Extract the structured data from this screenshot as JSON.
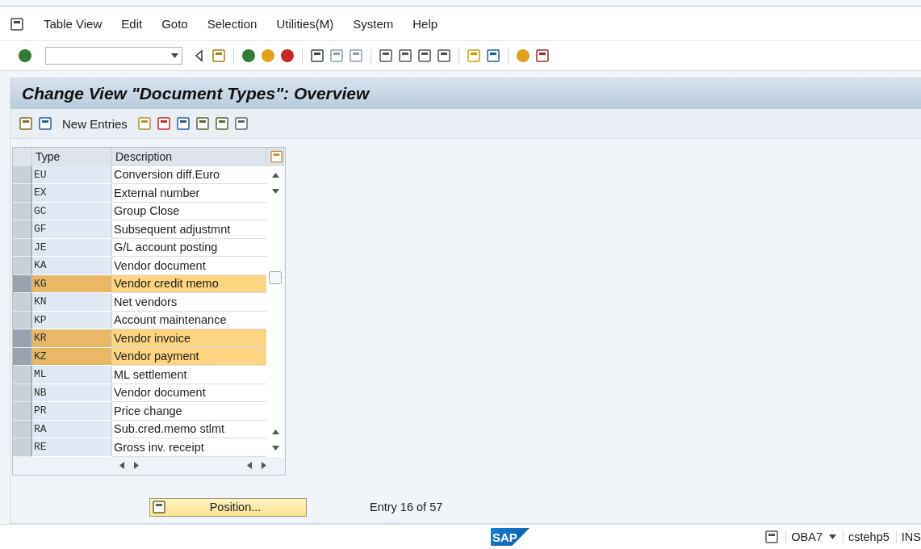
{
  "menu": [
    "Table View",
    "Edit",
    "Goto",
    "Selection",
    "Utilities(M)",
    "System",
    "Help"
  ],
  "title": "Change View \"Document Types\": Overview",
  "app_toolbar": {
    "new_entries": "New Entries"
  },
  "table": {
    "columns": [
      "Type",
      "Description"
    ],
    "rows": [
      {
        "type": "EU",
        "description": "Conversion diff.Euro",
        "selected": false
      },
      {
        "type": "EX",
        "description": "External number",
        "selected": false
      },
      {
        "type": "GC",
        "description": "Group Close",
        "selected": false
      },
      {
        "type": "GF",
        "description": "Subsequent adjustmnt",
        "selected": false
      },
      {
        "type": "JE",
        "description": "G/L account posting",
        "selected": false
      },
      {
        "type": "KA",
        "description": "Vendor document",
        "selected": false
      },
      {
        "type": "KG",
        "description": "Vendor credit memo",
        "selected": true
      },
      {
        "type": "KN",
        "description": "Net vendors",
        "selected": false
      },
      {
        "type": "KP",
        "description": "Account maintenance",
        "selected": false
      },
      {
        "type": "KR",
        "description": "Vendor invoice",
        "selected": true
      },
      {
        "type": "KZ",
        "description": "Vendor payment",
        "selected": true
      },
      {
        "type": "ML",
        "description": "ML settlement",
        "selected": false
      },
      {
        "type": "NB",
        "description": "Vendor document",
        "selected": false
      },
      {
        "type": "PR",
        "description": "Price change",
        "selected": false
      },
      {
        "type": "RA",
        "description": "Sub.cred.memo stlmt",
        "selected": false
      },
      {
        "type": "RE",
        "description": "Gross inv. receipt",
        "selected": false
      }
    ]
  },
  "position_button": "Position...",
  "entry_info": "Entry 16 of 57",
  "status_bar": {
    "logo": "SAP",
    "transaction": "OBA7",
    "server": "cstehp5",
    "mode": "INS"
  }
}
